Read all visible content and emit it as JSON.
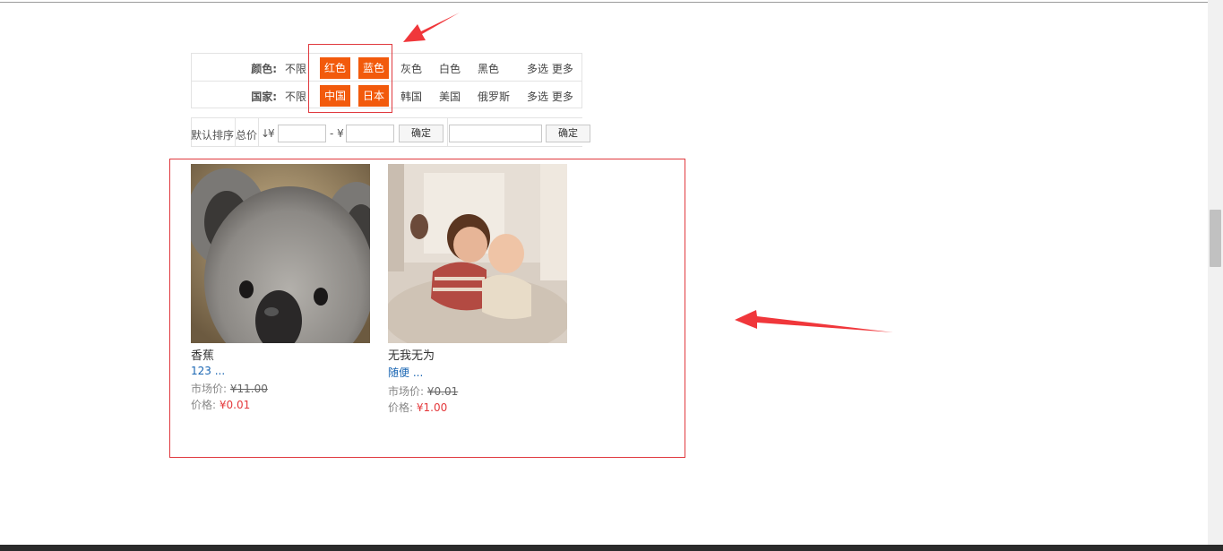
{
  "filters": {
    "color": {
      "label": "颜色:",
      "items": [
        "不限",
        "红色",
        "蓝色",
        "灰色",
        "白色",
        "黑色"
      ],
      "selected": [
        "红色",
        "蓝色"
      ],
      "multi_more": "多选 更多"
    },
    "country": {
      "label": "国家:",
      "items": [
        "不限",
        "中国",
        "日本",
        "韩国",
        "美国",
        "俄罗斯"
      ],
      "selected": [
        "中国",
        "日本"
      ],
      "multi_more": "多选 更多"
    }
  },
  "sortbar": {
    "default_sort": "默认排序",
    "total_price": "总价",
    "arrow": "↓",
    "currency": "¥",
    "dash": "- ¥",
    "min_value": "",
    "max_value": "",
    "confirm": "确定",
    "search_value": "",
    "confirm2": "确定"
  },
  "products": [
    {
      "name": "香蕉",
      "desc": "123 ...",
      "market_label": "市场价:",
      "market_price": "¥11.00",
      "price_label": "价格:",
      "price": "¥0.01",
      "image": "koala-photo"
    },
    {
      "name": "无我无为",
      "desc": "随便 ...",
      "market_label": "市场价:",
      "market_price": "¥0.01",
      "price_label": "价格:",
      "price": "¥1.00",
      "image": "children-photo"
    }
  ],
  "colors": {
    "accent": "#f25a0c",
    "highlight_border": "#e0393e",
    "price": "#e4393c",
    "link": "#1a66b3"
  }
}
